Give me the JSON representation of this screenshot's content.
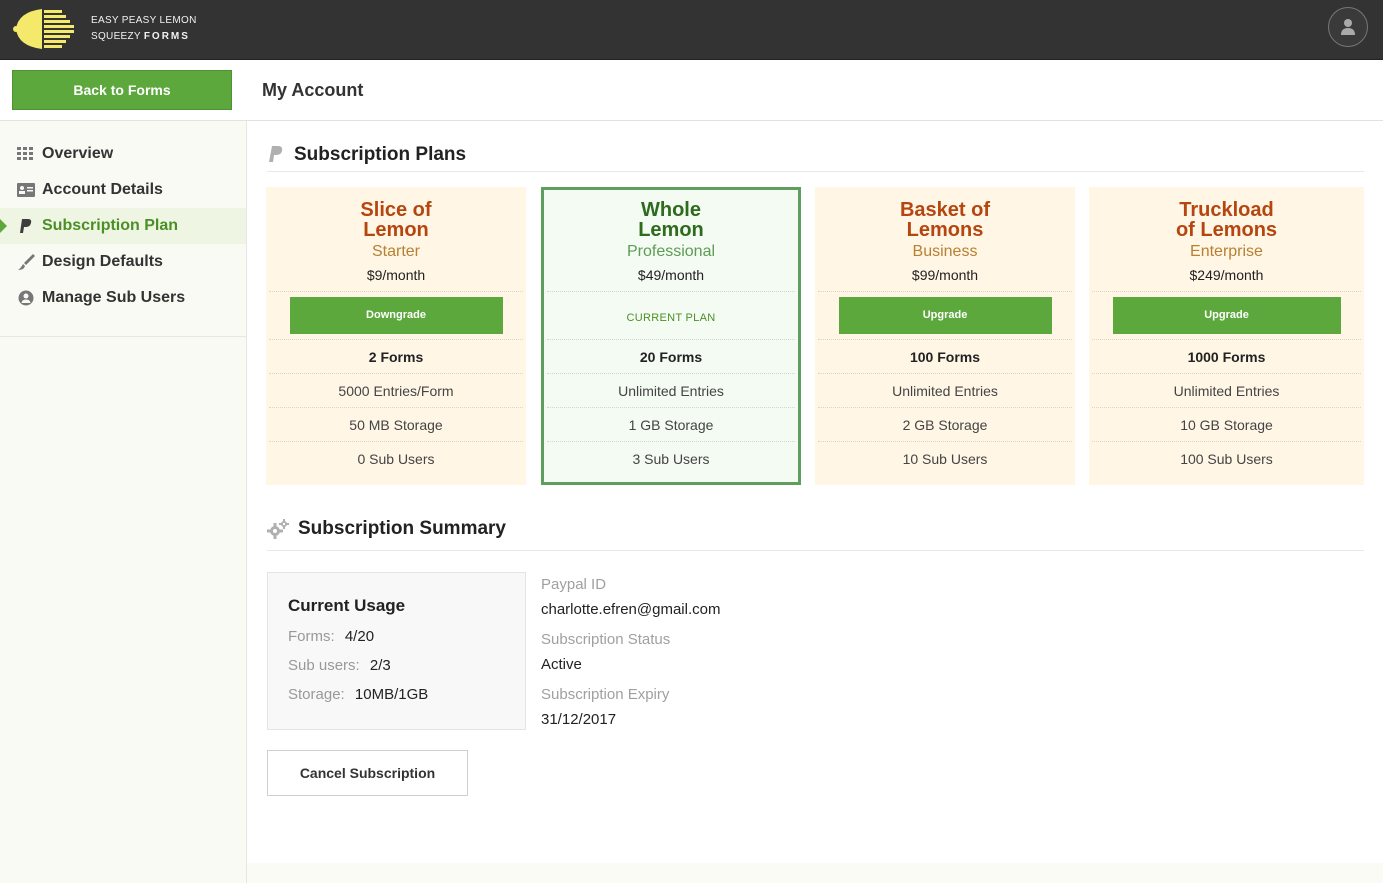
{
  "brand": {
    "line1": "EASY PEASY LEMON",
    "line2_a": "SQUEEZY",
    "line2_b": "FORMS"
  },
  "header": {
    "back_label": "Back to Forms",
    "page_title": "My Account"
  },
  "sidebar": {
    "items": [
      {
        "label": "Overview",
        "icon": "grid-icon"
      },
      {
        "label": "Account Details",
        "icon": "id-card-icon"
      },
      {
        "label": "Subscription Plan",
        "icon": "paypal-icon",
        "active": true
      },
      {
        "label": "Design Defaults",
        "icon": "brush-icon"
      },
      {
        "label": "Manage Sub Users",
        "icon": "user-circle-icon"
      }
    ]
  },
  "plans_section": {
    "title": "Subscription Plans"
  },
  "plans": [
    {
      "name1": "Slice of",
      "name2": "Lemon",
      "tier": "Starter",
      "price": "$9/month",
      "action": "Downgrade",
      "forms": "2 Forms",
      "entries": "5000 Entries/Form",
      "storage": "50 MB Storage",
      "subusers": "0 Sub Users"
    },
    {
      "name1": "Whole",
      "name2": "Lemon",
      "tier": "Professional",
      "price": "$49/month",
      "action": "CURRENT PLAN",
      "forms": "20 Forms",
      "entries": "Unlimited Entries",
      "storage": "1 GB Storage",
      "subusers": "3 Sub Users"
    },
    {
      "name1": "Basket of",
      "name2": "Lemons",
      "tier": "Business",
      "price": "$99/month",
      "action": "Upgrade",
      "forms": "100 Forms",
      "entries": "Unlimited Entries",
      "storage": "2 GB Storage",
      "subusers": "10 Sub Users"
    },
    {
      "name1": "Truckload",
      "name2": "of Lemons",
      "tier": "Enterprise",
      "price": "$249/month",
      "action": "Upgrade",
      "forms": "1000 Forms",
      "entries": "Unlimited Entries",
      "storage": "10 GB Storage",
      "subusers": "100 Sub Users"
    }
  ],
  "summary_section": {
    "title": "Subscription Summary"
  },
  "usage": {
    "title": "Current Usage",
    "forms_label": "Forms:",
    "forms_value": "4/20",
    "subusers_label": "Sub users:",
    "subusers_value": "2/3",
    "storage_label": "Storage:",
    "storage_value": "10MB/1GB"
  },
  "account": {
    "paypal_label": "Paypal ID",
    "paypal_value": "charlotte.efren@gmail.com",
    "status_label": "Subscription Status",
    "status_value": "Active",
    "expiry_label": "Subscription Expiry",
    "expiry_value": "31/12/2017"
  },
  "cancel_label": "Cancel Subscription",
  "colors": {
    "accent": "#5ca83d",
    "topbar": "#333333",
    "plan_title": "#b5460f",
    "current_plan_border": "#5f9e5f"
  }
}
